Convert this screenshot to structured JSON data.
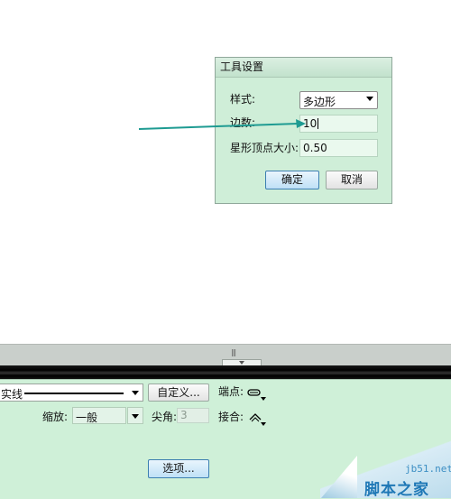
{
  "dialog": {
    "title": "工具设置",
    "style_label": "样式:",
    "style_value": "多边形",
    "sides_label": "边数:",
    "sides_value": "10",
    "star_label": "星形顶点大小:",
    "star_value": "0.50",
    "ok_label": "确定",
    "cancel_label": "取消"
  },
  "panel": {
    "grip_label": "|||",
    "stroke_value": "实线",
    "custom_button": "自定义...",
    "cap_label": "端点:",
    "scale_label": "缩放:",
    "scale_value": "一般",
    "miter_label": "尖角:",
    "miter_value": "3",
    "join_label": "接合:",
    "options_button": "选项..."
  },
  "watermark": {
    "url": "jb51.net",
    "name": "脚本之家"
  },
  "colors": {
    "dialog_bg": "#cfeed8",
    "panel_bg": "#cff0d8",
    "arrow": "#1e9b92",
    "default_button_border": "#3c7fb1"
  }
}
